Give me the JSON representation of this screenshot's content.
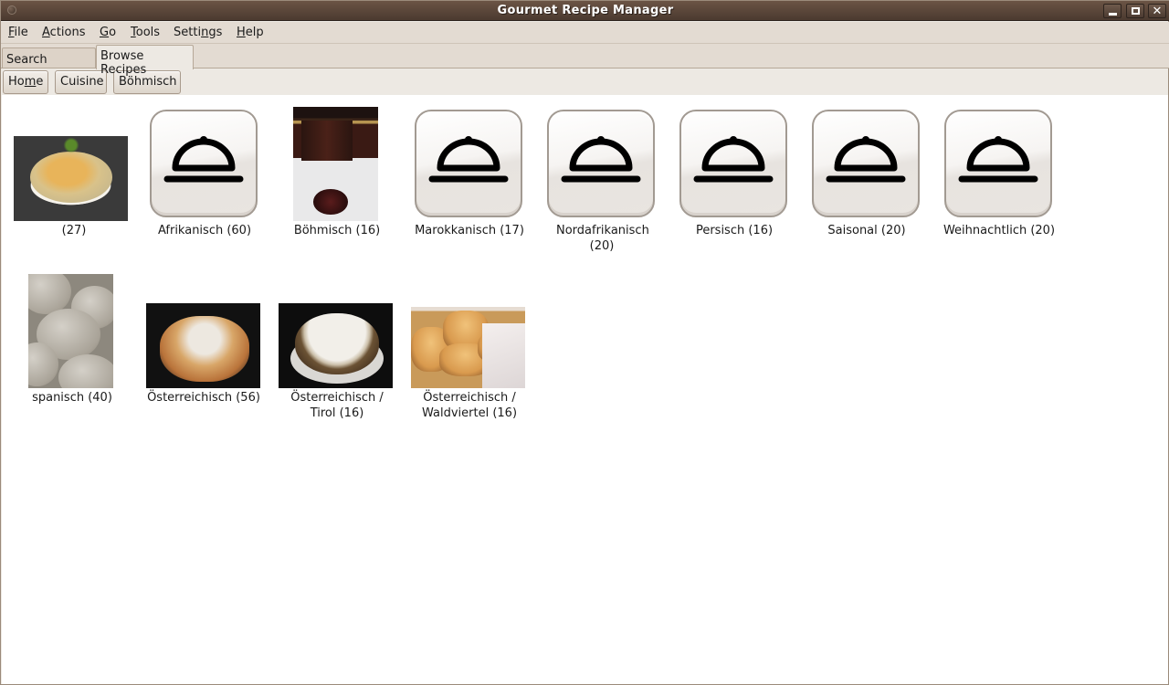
{
  "window": {
    "title": "Gourmet Recipe Manager",
    "controls": [
      "minimize",
      "maximize",
      "close"
    ]
  },
  "menubar": {
    "items": [
      {
        "label": "File",
        "mnemonic": "F"
      },
      {
        "label": "Actions",
        "mnemonic": "A"
      },
      {
        "label": "Go",
        "mnemonic": "G"
      },
      {
        "label": "Tools",
        "mnemonic": "T"
      },
      {
        "label": "Settings",
        "mnemonic": "n"
      },
      {
        "label": "Help",
        "mnemonic": "H"
      }
    ]
  },
  "tabs": [
    {
      "label": "Search recipes",
      "active": false
    },
    {
      "label": "Browse Recipes",
      "active": true
    }
  ],
  "breadcrumbs": [
    {
      "label_pre": "Ho",
      "label_mn": "m",
      "label_post": "e",
      "label": "Home"
    },
    {
      "label": "Cuisine"
    },
    {
      "label": "Böhmisch"
    }
  ],
  "browser": {
    "items": [
      {
        "label": "(27)",
        "icon": "photo-pasta"
      },
      {
        "label": "Afrikanisch (60)",
        "icon": "dish-cloche-icon"
      },
      {
        "label": "Böhmisch (16)",
        "icon": "photo-jam-jar"
      },
      {
        "label": "Marokkanisch (17)",
        "icon": "dish-cloche-icon"
      },
      {
        "label": "Nordafrikanisch (20)",
        "icon": "dish-cloche-icon"
      },
      {
        "label": "Persisch (16)",
        "icon": "dish-cloche-icon"
      },
      {
        "label": "Saisonal (20)",
        "icon": "dish-cloche-icon"
      },
      {
        "label": "Weihnachtlich (20)",
        "icon": "dish-cloche-icon"
      },
      {
        "label": "spanisch (40)",
        "icon": "photo-potatoes"
      },
      {
        "label": "Österreichisch (56)",
        "icon": "photo-souffle"
      },
      {
        "label": "Österreichisch / Tirol (16)",
        "icon": "photo-cake"
      },
      {
        "label": "Österreichisch / Waldviertel (16)",
        "icon": "photo-pastries"
      }
    ]
  }
}
